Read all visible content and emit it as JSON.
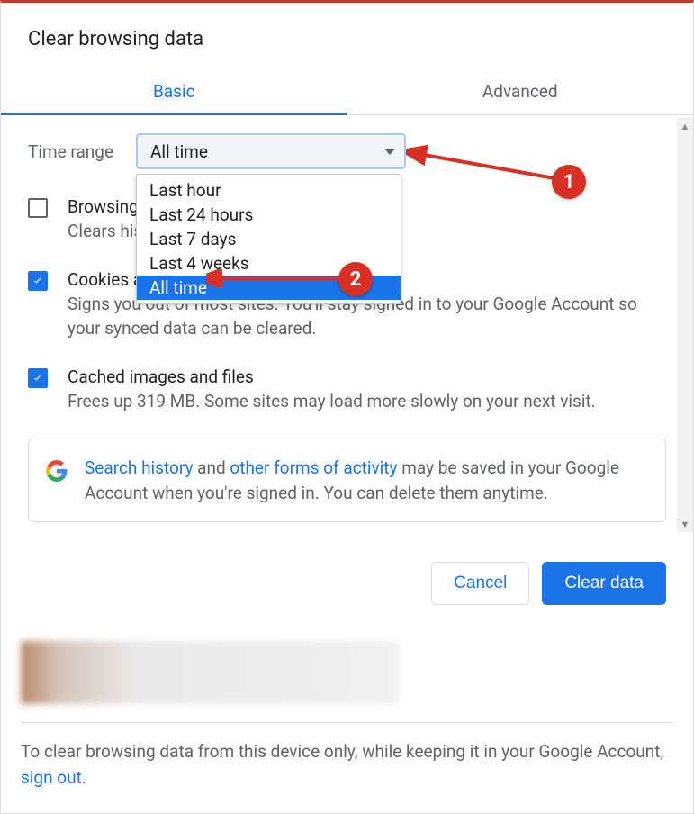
{
  "title": "Clear browsing data",
  "tabs": {
    "basic": "Basic",
    "advanced": "Advanced"
  },
  "time": {
    "label": "Time range",
    "selected": "All time",
    "options": [
      "Last hour",
      "Last 24 hours",
      "Last 7 days",
      "Last 4 weeks",
      "All time"
    ]
  },
  "items": [
    {
      "title": "Browsing history",
      "desc": "Clears history",
      "checked": false
    },
    {
      "title": "Cookies and other site data",
      "desc": "Signs you out of most sites. You'll stay signed in to your Google Account so your synced data can be cleared.",
      "checked": true
    },
    {
      "title": "Cached images and files",
      "desc": "Frees up 319 MB. Some sites may load more slowly on your next visit.",
      "checked": true
    }
  ],
  "info": {
    "link1": "Search history",
    "mid1": " and ",
    "link2": "other forms of activity",
    "rest": " may be saved in your Google Account when you're signed in. You can delete them anytime."
  },
  "buttons": {
    "cancel": "Cancel",
    "clear": "Clear data"
  },
  "bottom": {
    "text": "To clear browsing data from this device only, while keeping it in your Google Account, ",
    "link": "sign out",
    "period": "."
  },
  "annotations": {
    "step1": "1",
    "step2": "2"
  }
}
